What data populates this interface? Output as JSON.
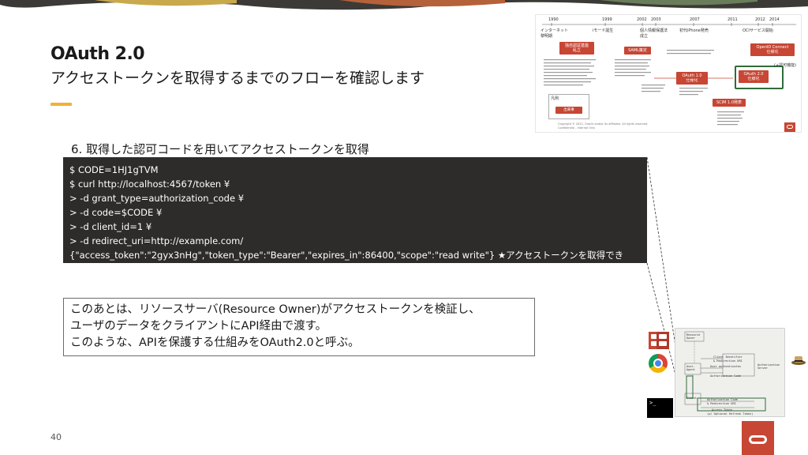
{
  "slide": {
    "title": "OAuth 2.0",
    "subtitle": "アクセストークンを取得するまでのフローを確認します",
    "step_title": "6. 取得した認可コードを用いてアクセストークンを取得",
    "terminal_lines": [
      "$ CODE=1HJ1gTVM",
      "$ curl http://localhost:4567/token ¥",
      "> -d grant_type=authorization_code ¥",
      "> -d code=$CODE ¥",
      "> -d client_id=1 ¥",
      "> -d redirect_uri=http://example.com/",
      "{\"access_token\":\"2gyx3nHg\",\"token_type\":\"Bearer\",\"expires_in\":86400,\"scope\":\"read write\"} ★アクセストークンを取得できた！"
    ],
    "note_lines": [
      "このあとは、リソースサーバ(Resource Owner)がアクセストークンを検証し、",
      "ユーザのデータをクライアントにAPI経由で渡す。",
      "このような、APIを保護する仕組みをOAuth2.0と呼ぶ。"
    ],
    "page_number": "40"
  },
  "history": {
    "years": [
      "1990",
      "1999",
      "2002",
      "2003",
      "2007",
      "2011",
      "2012",
      "2014"
    ],
    "eras": [
      "インターネット\n黎明期",
      "iモード誕生",
      "個人情報保護法\n成立",
      "初代iPhone発売",
      "OCIサービス開始"
    ],
    "boxes": [
      "独自認証基盤\n乱立",
      "SAML策定",
      "OAuth 1.0\n仕様化",
      "OAuth 2.0\n仕様化",
      "OpenID Connect\n仕様化",
      "SCIM 1.0発表",
      "出来事"
    ],
    "legend_title": "凡例",
    "legend_item": "出来事",
    "side_note": "(+認可機能)",
    "copyright": "Copyright © 2022, Oracle and/or its affiliates. All rights reserved.",
    "confidential": "Confidential - Internal Only"
  },
  "sequence": {
    "lines": [
      "Resource\nOwner",
      "Client Identifier",
      "& Redirection URI",
      "User authenticates",
      "Authorization\nServer",
      "Authorization Code",
      "User-\nAgent",
      "Authorization Code",
      "& Redirection URI",
      "Access Token",
      "(w/ Optional Refresh Token)",
      "Client"
    ]
  },
  "colors": {
    "accent": "#f0b13a",
    "oracle_red": "#c74634",
    "terminal_bg": "#2e2c2a",
    "highlight": "#2f6b3a"
  }
}
